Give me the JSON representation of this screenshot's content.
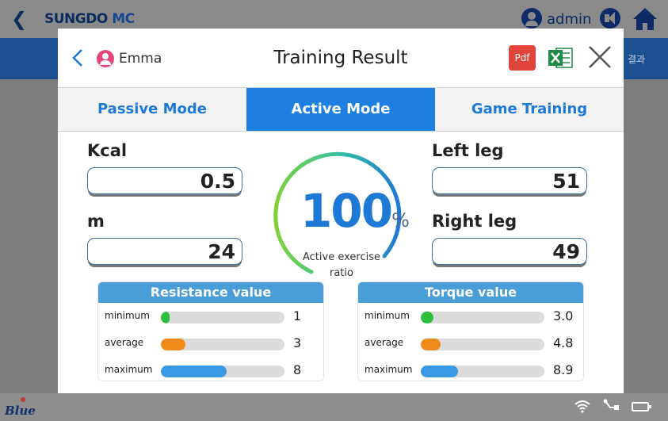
{
  "app": {
    "brand_main": "SUNGDO",
    "brand_sub": "MC",
    "user": "admin",
    "band_text": "결과",
    "logo_text": "Blue"
  },
  "dialog": {
    "patient": "Emma",
    "title": "Training Result",
    "pdf_label": "Pdf",
    "tabs": [
      {
        "label": "Passive Mode"
      },
      {
        "label": "Active Mode"
      },
      {
        "label": "Game Training"
      }
    ],
    "active_tab": "Active Mode"
  },
  "stats": {
    "kcal_label": "Kcal",
    "kcal_value": "0.5",
    "m_label": "m",
    "m_value": "24",
    "left_label": "Left leg",
    "left_value": "51",
    "right_label": "Right leg",
    "right_value": "49"
  },
  "gauge": {
    "value": "100",
    "unit": "%",
    "label": "Active exercise ratio",
    "fraction": 1.0
  },
  "resistance": {
    "title": "Resistance value",
    "rows": [
      {
        "label": "minimum",
        "value": "1",
        "fraction": 0.07,
        "color": "#2fbf3f"
      },
      {
        "label": "average",
        "value": "3",
        "fraction": 0.2,
        "color": "#f08a1a"
      },
      {
        "label": "maximum",
        "value": "8",
        "fraction": 0.53,
        "color": "#3a9ae6"
      }
    ]
  },
  "torque": {
    "title": "Torque value",
    "rows": [
      {
        "label": "minimum",
        "value": "3.0",
        "fraction": 0.1,
        "color": "#2fbf3f"
      },
      {
        "label": "average",
        "value": "4.8",
        "fraction": 0.16,
        "color": "#f08a1a"
      },
      {
        "label": "maximum",
        "value": "8.9",
        "fraction": 0.3,
        "color": "#3a9ae6"
      }
    ]
  },
  "colors": {
    "accent": "#1e7fe3",
    "panel_head": "#4a9ed8",
    "band": "#1d4f93"
  }
}
